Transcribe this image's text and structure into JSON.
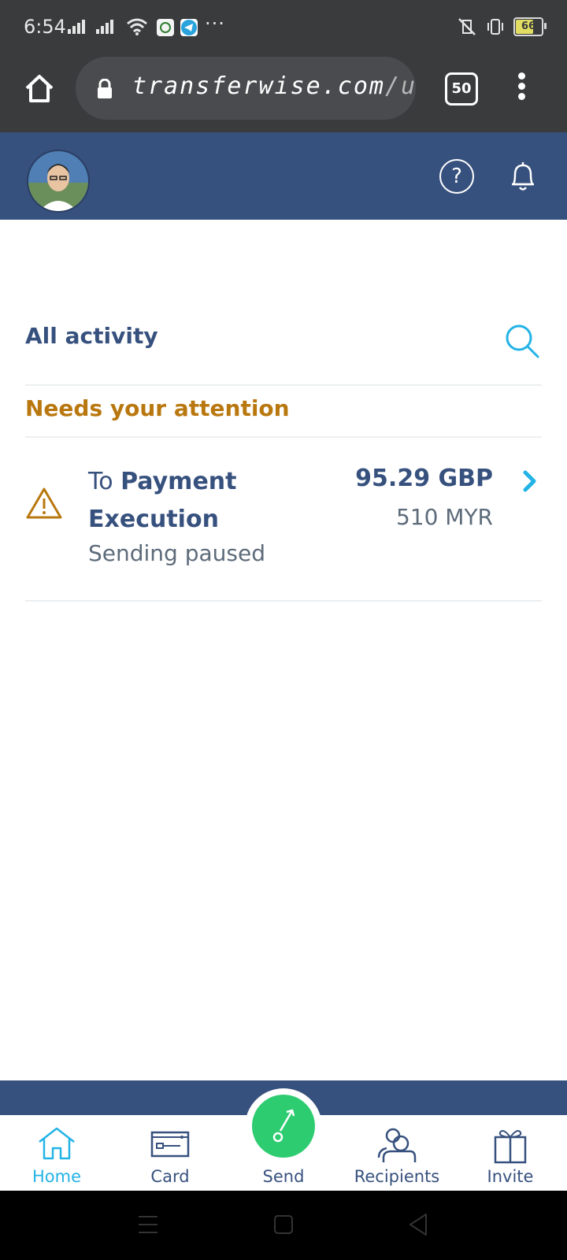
{
  "status_bar": {
    "time": "6:54",
    "battery_level": "66",
    "icons": [
      "signal-icon",
      "signal-icon",
      "wifi-icon",
      "app-notification-icon",
      "telegram-icon",
      "more-notifications-icon",
      "vibrate-mute-icon",
      "vibrate-icon",
      "battery-icon"
    ],
    "overflow_dots": "···"
  },
  "browser": {
    "url_host": "transferwise.com",
    "url_path": "/user/c",
    "tab_count": "50"
  },
  "header": {
    "help_symbol": "?"
  },
  "activity": {
    "title": "All activity",
    "section_label": "Needs your attention",
    "items": [
      {
        "title_prefix": "To ",
        "title_name": "Payment Execution",
        "status": "Sending paused",
        "amount": "95.29 GBP",
        "sub_amount": "510 MYR"
      }
    ]
  },
  "bottom_nav": {
    "items": [
      {
        "label": "Home",
        "icon": "home-icon",
        "active": true
      },
      {
        "label": "Card",
        "icon": "card-icon",
        "active": false
      },
      {
        "label": "Send",
        "icon": "send-arrow-icon",
        "active": false
      },
      {
        "label": "Recipients",
        "icon": "recipients-icon",
        "active": false
      },
      {
        "label": "Invite",
        "icon": "gift-icon",
        "active": false
      }
    ]
  },
  "colors": {
    "brand_navy": "#37517e",
    "accent_blue": "#23b3e6",
    "attention_amber": "#b9780f",
    "send_green": "#2ecc71",
    "browser_chrome": "#3a3b3d"
  }
}
